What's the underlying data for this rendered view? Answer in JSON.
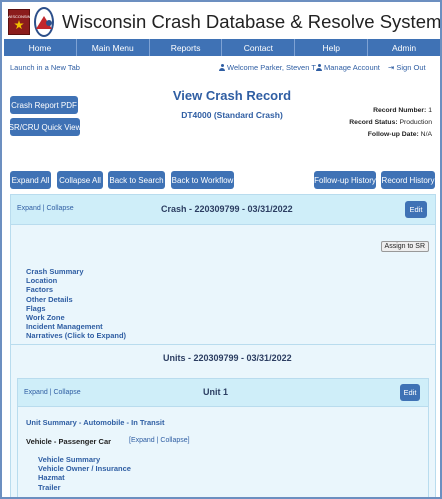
{
  "app": {
    "title": "Wisconsin Crash Database & Resolve System",
    "logo_left_text": "WISCONSIN"
  },
  "nav": [
    "Home",
    "Main Menu",
    "Reports",
    "Contact",
    "Help",
    "Admin"
  ],
  "subbar": {
    "launch": "Launch in a New Tab",
    "welcome": "Welcome Parker, Steven T",
    "manage": "Manage Account",
    "signout": "Sign Out"
  },
  "buttons": {
    "crash_report_pdf": "Crash Report PDF",
    "sr_cru_quick_view": "SR/CRU Quick View",
    "expand_all": "Expand All",
    "collapse_all": "Collapse All",
    "back_to_search": "Back to Search",
    "back_to_workflow": "Back to Workflow",
    "followup_history": "Follow-up History",
    "record_history": "Record History",
    "edit": "Edit",
    "assign_to_sr": "Assign to SR"
  },
  "view": {
    "title": "View Crash Record",
    "subtitle": "DT4000 (Standard Crash)"
  },
  "record": {
    "number_label": "Record Number:",
    "number": "1",
    "status_label": "Record Status:",
    "status": "Production",
    "followup_label": "Follow-up Date:",
    "followup": "N/A"
  },
  "crash_panel": {
    "expand_collapse": "Expand | Collapse",
    "title": "Crash - 220309799 - 03/31/2022",
    "links": [
      "Crash Summary",
      "Location",
      "Factors",
      "Other Details",
      "Flags",
      "Work Zone",
      "Incident Management",
      "Narratives (Click to Expand)"
    ]
  },
  "units_panel": {
    "title": "Units - 220309799 - 03/31/2022",
    "unit": {
      "expand_collapse": "Expand | Collapse",
      "title": "Unit 1",
      "summary": "Unit Summary - Automobile - In Transit",
      "vehicle": "Vehicle - Passenger Car",
      "vehicle_expand": "[Expand | Collapse]",
      "links": [
        "Vehicle Summary",
        "Vehicle Owner / Insurance",
        "Hazmat",
        "Trailer"
      ]
    }
  },
  "colors": {
    "accent": "#3f72b5",
    "panel_bg": "#eaf6fc",
    "panel_head": "#cfeef9",
    "link": "#2f5ea3"
  }
}
